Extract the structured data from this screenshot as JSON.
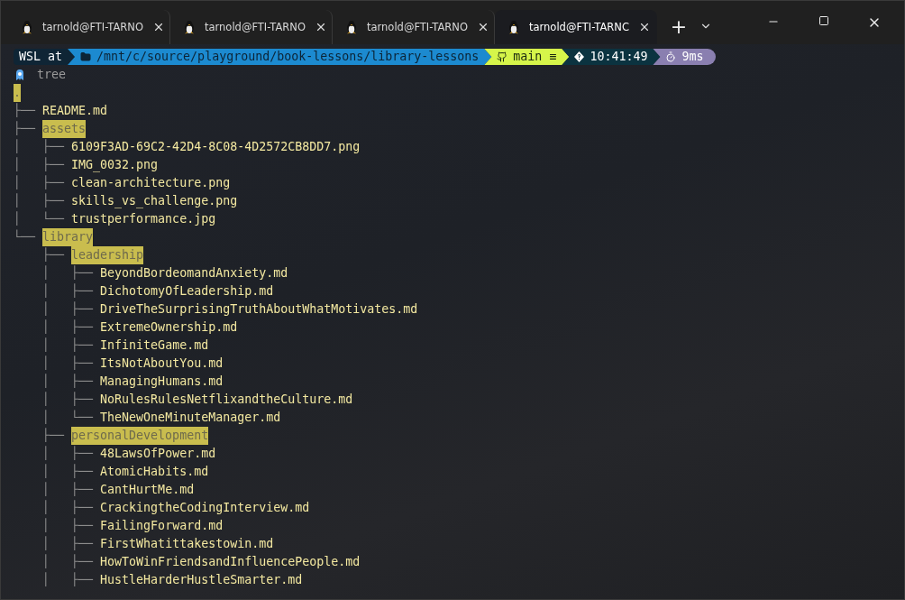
{
  "tabs": [
    {
      "label": "tarnold@FTI-TARNO",
      "selected": false
    },
    {
      "label": "tarnold@FTI-TARNO",
      "selected": false
    },
    {
      "label": "tarnold@FTI-TARNO",
      "selected": false
    },
    {
      "label": "tarnold@FTI-TARNC",
      "selected": true
    }
  ],
  "new_tab": "+",
  "prompt": {
    "segments": [
      {
        "kind": "host",
        "text": "WSL at"
      },
      {
        "kind": "path",
        "text": "/mnt/c/source/playground/book-lessons/library-lessons"
      },
      {
        "kind": "git",
        "text": "main",
        "status": "≡"
      },
      {
        "kind": "time",
        "text": "10:41:49"
      },
      {
        "kind": "duration",
        "text": "9ms"
      }
    ],
    "command": "tree"
  },
  "tree": {
    "root": ".",
    "children": [
      {
        "prefix": "├── ",
        "name": "README.md",
        "kind": "file"
      },
      {
        "prefix": "├── ",
        "name": "assets",
        "kind": "dir",
        "children": [
          {
            "prefix": "│   ├── ",
            "name": "6109F3AD-69C2-42D4-8C08-4D2572CB8DD7.png",
            "kind": "file"
          },
          {
            "prefix": "│   ├── ",
            "name": "IMG_0032.png",
            "kind": "file"
          },
          {
            "prefix": "│   ├── ",
            "name": "clean-architecture.png",
            "kind": "file"
          },
          {
            "prefix": "│   ├── ",
            "name": "skills_vs_challenge.png",
            "kind": "file"
          },
          {
            "prefix": "│   └── ",
            "name": "trustperformance.jpg",
            "kind": "file"
          }
        ]
      },
      {
        "prefix": "└── ",
        "name": "library",
        "kind": "dir",
        "children": [
          {
            "prefix": "    ├── ",
            "name": "leadership",
            "kind": "dir",
            "children": [
              {
                "prefix": "    │   ├── ",
                "name": "BeyondBordeomandAnxiety.md",
                "kind": "file"
              },
              {
                "prefix": "    │   ├── ",
                "name": "DichotomyOfLeadership.md",
                "kind": "file"
              },
              {
                "prefix": "    │   ├── ",
                "name": "DriveTheSurprisingTruthAboutWhatMotivates.md",
                "kind": "file"
              },
              {
                "prefix": "    │   ├── ",
                "name": "ExtremeOwnership.md",
                "kind": "file"
              },
              {
                "prefix": "    │   ├── ",
                "name": "InfiniteGame.md",
                "kind": "file"
              },
              {
                "prefix": "    │   ├── ",
                "name": "ItsNotAboutYou.md",
                "kind": "file"
              },
              {
                "prefix": "    │   ├── ",
                "name": "ManagingHumans.md",
                "kind": "file"
              },
              {
                "prefix": "    │   ├── ",
                "name": "NoRulesRulesNetflixandtheCulture.md",
                "kind": "file"
              },
              {
                "prefix": "    │   └── ",
                "name": "TheNewOneMinuteManager.md",
                "kind": "file"
              }
            ]
          },
          {
            "prefix": "    ├── ",
            "name": "personalDevelopment",
            "kind": "dir",
            "children": [
              {
                "prefix": "    │   ├── ",
                "name": "48LawsOfPower.md",
                "kind": "file"
              },
              {
                "prefix": "    │   ├── ",
                "name": "AtomicHabits.md",
                "kind": "file"
              },
              {
                "prefix": "    │   ├── ",
                "name": "CantHurtMe.md",
                "kind": "file"
              },
              {
                "prefix": "    │   ├── ",
                "name": "CrackingtheCodingInterview.md",
                "kind": "file"
              },
              {
                "prefix": "    │   ├── ",
                "name": "FailingForward.md",
                "kind": "file"
              },
              {
                "prefix": "    │   ├── ",
                "name": "FirstWhatittakestowin.md",
                "kind": "file"
              },
              {
                "prefix": "    │   ├── ",
                "name": "HowToWinFriendsandInfluencePeople.md",
                "kind": "file"
              },
              {
                "prefix": "    │   ├── ",
                "name": "HustleHarderHustleSmarter.md",
                "kind": "file"
              }
            ]
          }
        ]
      }
    ]
  }
}
